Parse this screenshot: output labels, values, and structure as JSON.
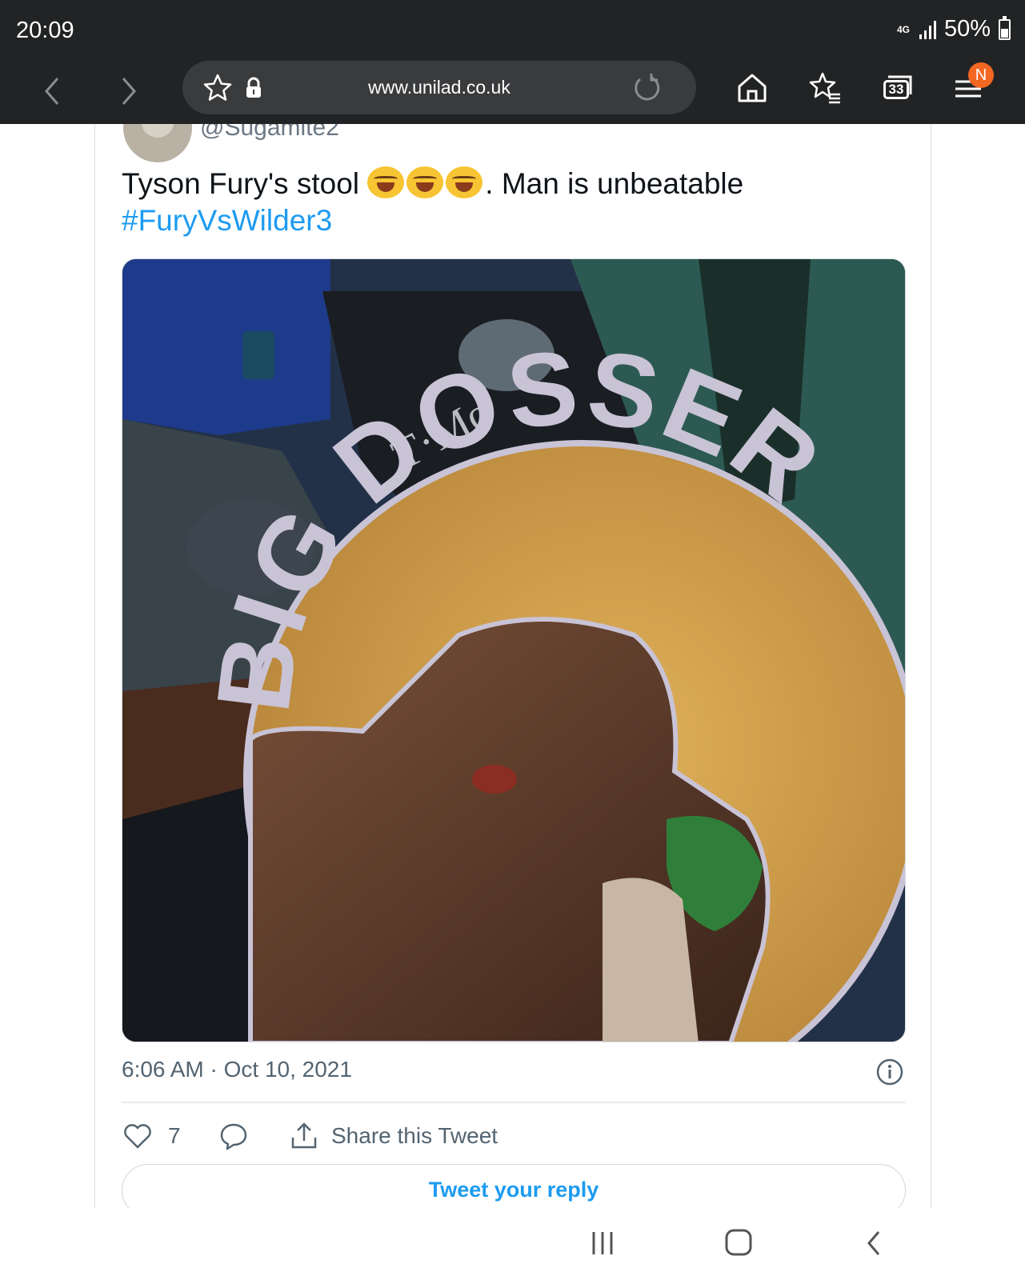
{
  "status_bar": {
    "time": "20:09",
    "network": "4G",
    "battery": "50%"
  },
  "browser": {
    "url": "www.unilad.co.uk",
    "tab_count": "33",
    "notification_badge": "N",
    "icons": [
      "back-icon",
      "forward-icon",
      "star-icon",
      "lock-icon",
      "reload-icon",
      "home-icon",
      "bookmarks-icon",
      "tabs-icon",
      "menu-icon"
    ]
  },
  "tweet": {
    "handle": "@Sugamite2",
    "text_part1": "Tyson Fury's stool ",
    "text_part2": ". Man is unbeatable",
    "hashtag": "#FuryVsWilder3",
    "emoji_name": "face-with-tears-of-joy",
    "timestamp": "6:06 AM · Oct 10, 2021",
    "likes": "7",
    "share_label": "Share this Tweet",
    "reply_label": "Tweet your reply"
  },
  "photo": {
    "sign_text": "BIG DOSSER",
    "banner_text": "T·Mo"
  },
  "colors": {
    "chrome_bg": "#222324",
    "link": "#1d9bf0",
    "badge": "#f26722",
    "sign_gold": "#d3a24a"
  }
}
